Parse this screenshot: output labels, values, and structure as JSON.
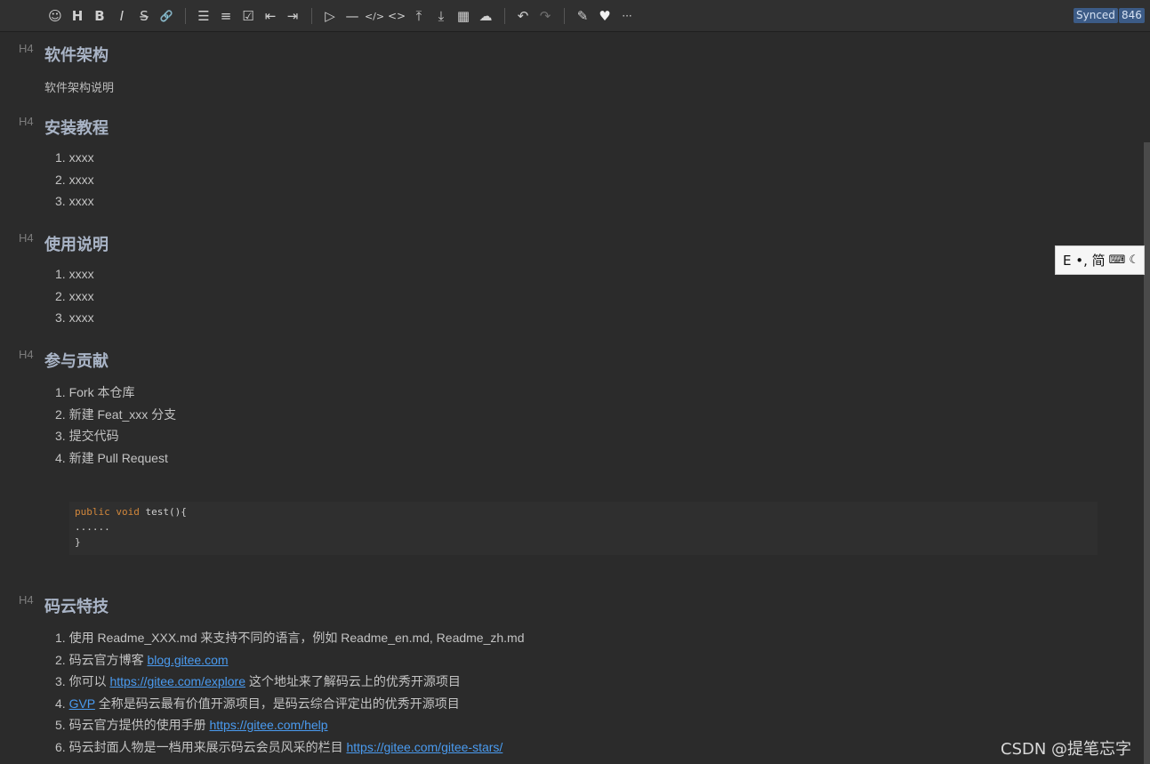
{
  "toolbar": {
    "buttons": [
      {
        "name": "emoji-icon",
        "glyph": "☺"
      },
      {
        "name": "heading-icon",
        "glyph": "H"
      },
      {
        "name": "bold-icon",
        "glyph": "B"
      },
      {
        "name": "italic-icon",
        "glyph": "I"
      },
      {
        "name": "strikethrough-icon",
        "glyph": "S̶"
      },
      {
        "name": "link-icon",
        "glyph": "🔗"
      },
      {
        "name": "bullet-list-icon",
        "glyph": "☰"
      },
      {
        "name": "ordered-list-icon",
        "glyph": "≡"
      },
      {
        "name": "checklist-icon",
        "glyph": "☑"
      },
      {
        "name": "outdent-icon",
        "glyph": "⇤"
      },
      {
        "name": "indent-icon",
        "glyph": "⇥"
      },
      {
        "name": "quote-icon",
        "glyph": "▷"
      },
      {
        "name": "horizontal-rule-icon",
        "glyph": "—"
      },
      {
        "name": "inline-code-icon",
        "glyph": "</>"
      },
      {
        "name": "code-block-icon",
        "glyph": "<>"
      },
      {
        "name": "insert-before-icon",
        "glyph": "⤒"
      },
      {
        "name": "insert-after-icon",
        "glyph": "⤓"
      },
      {
        "name": "table-icon",
        "glyph": "▦"
      },
      {
        "name": "upload-icon",
        "glyph": "☁"
      },
      {
        "name": "undo-icon",
        "glyph": "↶"
      },
      {
        "name": "redo-icon",
        "glyph": "↷"
      },
      {
        "name": "edit-mode-icon",
        "glyph": "✎"
      },
      {
        "name": "heart-icon",
        "glyph": "♥"
      },
      {
        "name": "more-icon",
        "glyph": "···"
      }
    ],
    "status": "Synced",
    "count": "846"
  },
  "sections": [
    {
      "mark": "H4",
      "title": "软件架构",
      "para": "软件架构说明"
    },
    {
      "mark": "H4",
      "title": "安装教程",
      "items": [
        "1. xxxx",
        "2. xxxx",
        "3. xxxx"
      ]
    },
    {
      "mark": "H4",
      "title": "使用说明",
      "items": [
        "1. xxxx",
        "2. xxxx",
        "3. xxxx"
      ]
    },
    {
      "mark": "H4",
      "title": "参与贡献",
      "items": [
        "1. Fork 本仓库",
        "2. 新建 Feat_xxx 分支",
        "3. 提交代码",
        "4. 新建 Pull Request"
      ]
    },
    {
      "mark": "H4",
      "title": "码云特技"
    }
  ],
  "code": {
    "keyword1": "public",
    "keyword2": "void",
    "rest": " test(){",
    "line2": "......",
    "line3": "}"
  },
  "features": [
    {
      "prefix": "1. 使用 Readme_XXX.md 来支持不同的语言，例如 Readme_en.md, Readme_zh.md",
      "link": "",
      "suffix": ""
    },
    {
      "prefix": "2. 码云官方博客 ",
      "link": "blog.gitee.com",
      "suffix": ""
    },
    {
      "prefix": "3. 你可以 ",
      "link": "https://gitee.com/explore",
      "suffix": " 这个地址来了解码云上的优秀开源项目"
    },
    {
      "prefix": "4. ",
      "link": "GVP",
      "suffix": " 全称是码云最有价值开源项目，是码云综合评定出的优秀开源项目"
    },
    {
      "prefix": "5. 码云官方提供的使用手册 ",
      "link": "https://gitee.com/help",
      "suffix": ""
    },
    {
      "prefix": "6. 码云封面人物是一档用来展示码云会员风采的栏目 ",
      "link": "https://gitee.com/gitee-stars/",
      "suffix": ""
    }
  ],
  "ime": {
    "text": "E •, 简"
  },
  "watermark": "CSDN @提笔忘字"
}
